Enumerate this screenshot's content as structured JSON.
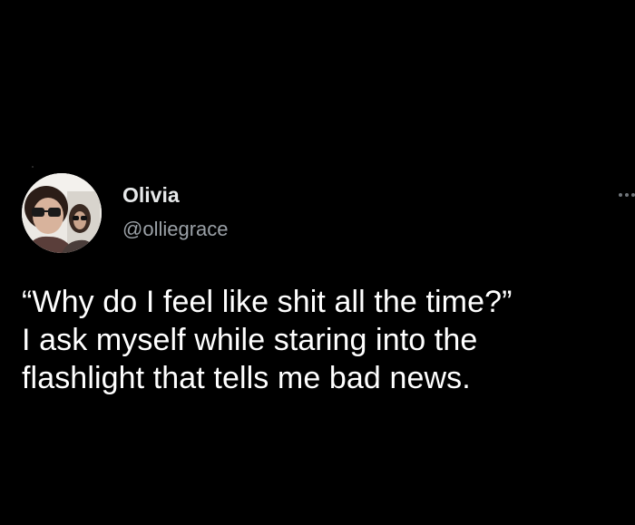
{
  "author": {
    "display_name": "Olivia",
    "handle": "@olliegrace",
    "avatar_icon": "profile-photo-icon"
  },
  "more_icon": "more-options-icon",
  "tweet": {
    "lines": [
      "“Why do I feel like shit all the time?”",
      "I ask myself while staring into the",
      "flashlight that tells me bad news."
    ]
  },
  "colors": {
    "background": "#000000",
    "name": "#e7e9ea",
    "handle": "#9aa0a6",
    "text": "#ffffff"
  }
}
